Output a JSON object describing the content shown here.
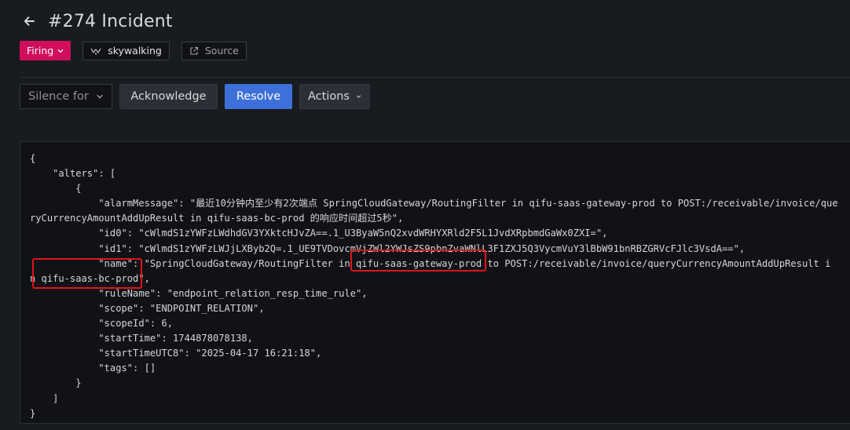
{
  "header": {
    "title": "#274 Incident"
  },
  "status": {
    "label": "Firing",
    "color": "#d10e5c"
  },
  "integration": {
    "label": "skywalking"
  },
  "source": {
    "label": "Source"
  },
  "toolbar": {
    "silence_label": "Silence for",
    "acknowledge_label": "Acknowledge",
    "resolve_label": "Resolve",
    "actions_label": "Actions"
  },
  "payload": {
    "lines": [
      "{",
      "    \"alters\": [",
      "        {",
      "            \"alarmMessage\": \"最近10分钟内至少有2次端点 SpringCloudGateway/RoutingFilter in qifu-saas-gateway-prod to POST:/receivable/invoice/que",
      "ryCurrencyAmountAddUpResult in qifu-saas-bc-prod 的响应时间超过5秒\",",
      "            \"id0\": \"cWlmdS1zYWFzLWdhdGV3YXktcHJvZA==.1_U3ByaW5nQ2xvdWRHYXRld2F5L1JvdXRpbmdGaWx0ZXI=\",",
      "            \"id1\": \"cWlmdS1zYWFzLWJjLXByb2Q=.1_UE9TVDovcmVjZWl2YWJsZS9pbnZvaWNlL3F1ZXJ5Q3VycmVuY3lBbW91bnRBZGRVcFJlc3VsdA==\",",
      "            \"name\": \"SpringCloudGateway/RoutingFilter in qifu-saas-gateway-prod to POST:/receivable/invoice/queryCurrencyAmountAddUpResult i",
      "n qifu-saas-bc-prod\",",
      "            \"ruleName\": \"endpoint_relation_resp_time_rule\",",
      "            \"scope\": \"ENDPOINT_RELATION\",",
      "            \"scopeId\": 6,",
      "            \"startTime\": 1744878078138,",
      "            \"startTimeUTC8\": \"2025-04-17 16:21:18\",",
      "            \"tags\": []",
      "        }",
      "    ]",
      "}"
    ]
  },
  "highlight_color": "#e0141c"
}
